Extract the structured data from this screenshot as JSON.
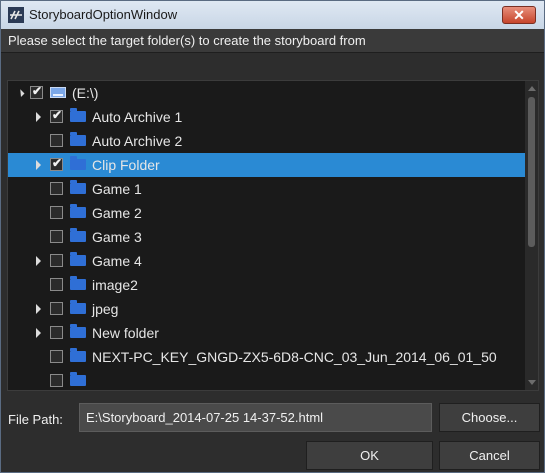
{
  "window": {
    "title": "StoryboardOptionWindow",
    "close_glyph": "✕"
  },
  "instruction": "Please select the target folder(s) to create the storyboard from",
  "tree": {
    "rows": [
      {
        "label": "(E:\\)",
        "level": 0,
        "expander": "open",
        "checked": true,
        "icon": "drive-icon",
        "selected": false
      },
      {
        "label": "Auto Archive 1",
        "level": 1,
        "expander": "closed",
        "checked": true,
        "icon": "folder-icon",
        "selected": false
      },
      {
        "label": "Auto Archive 2",
        "level": 1,
        "expander": "none",
        "checked": false,
        "icon": "folder-icon",
        "selected": false
      },
      {
        "label": "Clip Folder",
        "level": 1,
        "expander": "closed",
        "checked": true,
        "icon": "folder-icon",
        "selected": true
      },
      {
        "label": "Game 1",
        "level": 1,
        "expander": "none",
        "checked": false,
        "icon": "folder-icon",
        "selected": false
      },
      {
        "label": "Game 2",
        "level": 1,
        "expander": "none",
        "checked": false,
        "icon": "folder-icon",
        "selected": false
      },
      {
        "label": "Game 3",
        "level": 1,
        "expander": "none",
        "checked": false,
        "icon": "folder-icon",
        "selected": false
      },
      {
        "label": "Game 4",
        "level": 1,
        "expander": "closed",
        "checked": false,
        "icon": "folder-icon",
        "selected": false
      },
      {
        "label": "image2",
        "level": 1,
        "expander": "none",
        "checked": false,
        "icon": "folder-icon",
        "selected": false
      },
      {
        "label": "jpeg",
        "level": 1,
        "expander": "closed",
        "checked": false,
        "icon": "folder-icon",
        "selected": false
      },
      {
        "label": "New folder",
        "level": 1,
        "expander": "closed",
        "checked": false,
        "icon": "folder-icon",
        "selected": false
      },
      {
        "label": "NEXT-PC_KEY_GNGD-ZX5-6D8-CNC_03_Jun_2014_06_01_50",
        "level": 1,
        "expander": "none",
        "checked": false,
        "icon": "folder-icon",
        "selected": false
      },
      {
        "label": "",
        "level": 1,
        "expander": "none",
        "checked": false,
        "icon": "folder-icon",
        "selected": false
      }
    ]
  },
  "file_path": {
    "label": "File Path:",
    "value": "E:\\Storyboard_2014-07-25 14-37-52.html"
  },
  "buttons": {
    "choose": "Choose...",
    "ok": "OK",
    "cancel": "Cancel"
  },
  "colors": {
    "selection": "#2a8ad4",
    "folder": "#2f6fd6"
  }
}
